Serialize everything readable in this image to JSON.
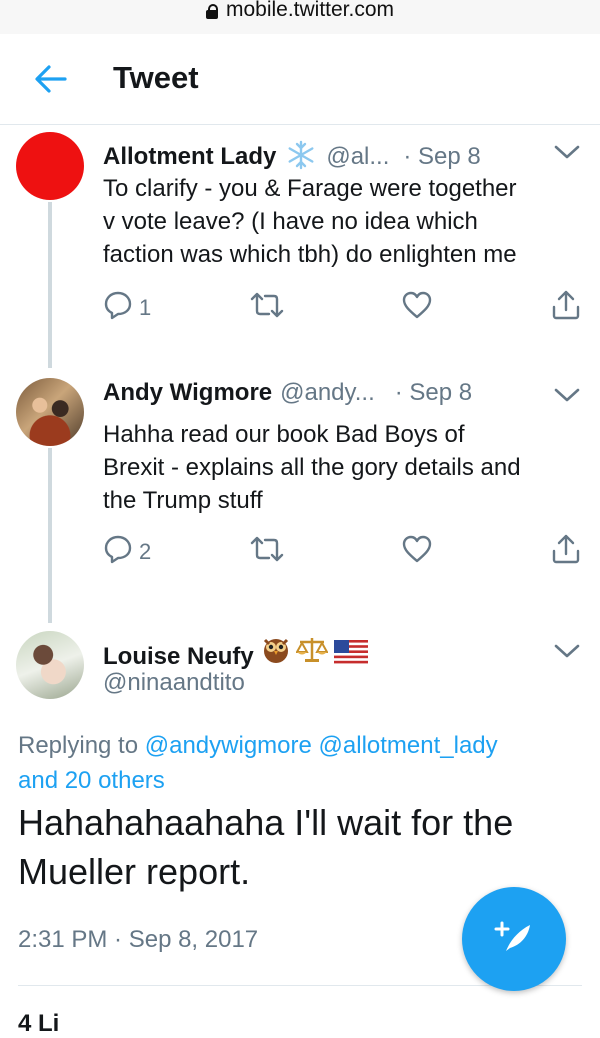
{
  "browser": {
    "url": "mobile.twitter.com"
  },
  "header": {
    "title": "Tweet"
  },
  "tweets": [
    {
      "name": "Allotment Lady",
      "badge": "snowflake",
      "handle": "@al...",
      "time": "· Sep 8",
      "text_lines": [
        "To clarify - you & Farage were together",
        "v vote leave? (I have no idea which",
        "faction was which tbh) do enlighten me"
      ],
      "reply_count": "1",
      "avatar_color": "#ee1111"
    },
    {
      "name": "Andy Wigmore",
      "handle": "@andy...",
      "time": "· Sep 8",
      "text_lines": [
        "Hahha read our book Bad Boys of",
        "Brexit - explains all the gory details and",
        "the Trump stuff"
      ],
      "reply_count": "2"
    }
  ],
  "main_tweet": {
    "name": "Louise Neufy",
    "name_emojis": [
      "owl",
      "scales",
      "us-flag"
    ],
    "handle": "@ninaandtito",
    "replying_prefix": "Replying to",
    "replying_mention_1": "@andywigmore",
    "replying_mention_2": "@allotment_lady",
    "replying_others": "and 20 others",
    "text_line_1": "Hahahahaahaha I'll wait for the",
    "text_line_2": "Mueller report.",
    "timestamp": "2:31 PM · Sep 8, 2017",
    "likes_partial": "4 Li"
  },
  "colors": {
    "accent": "#1da1f2",
    "muted": "#657786",
    "thread_line": "#cfd9de"
  },
  "icons": [
    "lock-icon",
    "back-arrow-icon",
    "chevron-down-icon",
    "reply-icon",
    "retweet-icon",
    "like-icon",
    "share-icon",
    "compose-tweet-icon"
  ]
}
